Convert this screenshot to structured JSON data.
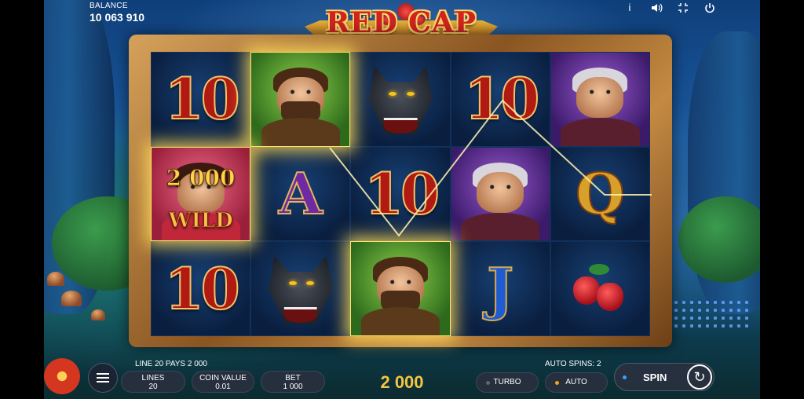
{
  "header": {
    "balance_label": "BALANCE",
    "balance_value": "10 063 910",
    "icons": [
      "info-icon",
      "sound-icon",
      "fullscreen-icon",
      "power-icon"
    ]
  },
  "logo": {
    "title": "RED CAP"
  },
  "reels": [
    [
      "10",
      "hunter",
      "wolf",
      "10",
      "grandma"
    ],
    [
      "wild",
      "A",
      "10",
      "grandma",
      "Q"
    ],
    [
      "10",
      "wolf",
      "hunter",
      "J",
      "strawberry"
    ]
  ],
  "symbols": {
    "ten": "10",
    "ace": "A",
    "queen": "Q",
    "jack": "J",
    "wild_label": "WILD",
    "wild_win_amount": "2 000"
  },
  "status": {
    "line_win": "LINE 20 PAYS 2 000",
    "auto_spins": "AUTO SPINS: 2"
  },
  "controls": {
    "lines_label": "LINES",
    "lines_value": "20",
    "coin_value_label": "COIN VALUE",
    "coin_value_value": "0.01",
    "bet_label": "BET",
    "bet_value": "1 000",
    "win_amount": "2 000",
    "turbo_label": "TURBO",
    "auto_label": "AUTO",
    "spin_label": "SPIN"
  },
  "colors": {
    "highlight": "#ffe36a",
    "accent_gold": "#f4c542",
    "spin_dot": "#3aa0ff",
    "auto_dot": "#f4a21a"
  }
}
